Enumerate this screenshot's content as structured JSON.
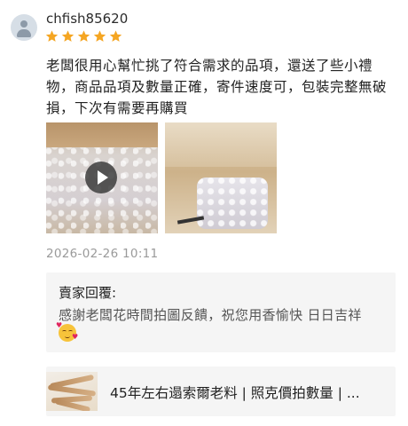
{
  "review": {
    "username": "chfish85620",
    "rating": 5,
    "text": "老闆很用心幫忙挑了符合需求的品項，還送了些小禮物，商品品項及數量正確，寄件速度可，包裝完整無破損，下次有需要再購買",
    "timestamp": "2026-02-26 10:11",
    "media": [
      {
        "kind": "video",
        "icon": "play-icon"
      },
      {
        "kind": "photo"
      }
    ]
  },
  "seller_reply": {
    "label": "賣家回覆:",
    "text": "感謝老闆花時間拍圖反饋，祝您用香愉快 日日吉祥",
    "emoji": "smiling-face-with-hearts"
  },
  "product": {
    "title": "45年左右遢索爾老料 | 照克價拍數量 | ..."
  },
  "colors": {
    "star": "#f5a623",
    "reply_bg": "#f5f5f5",
    "timestamp": "#9a9a9a"
  }
}
